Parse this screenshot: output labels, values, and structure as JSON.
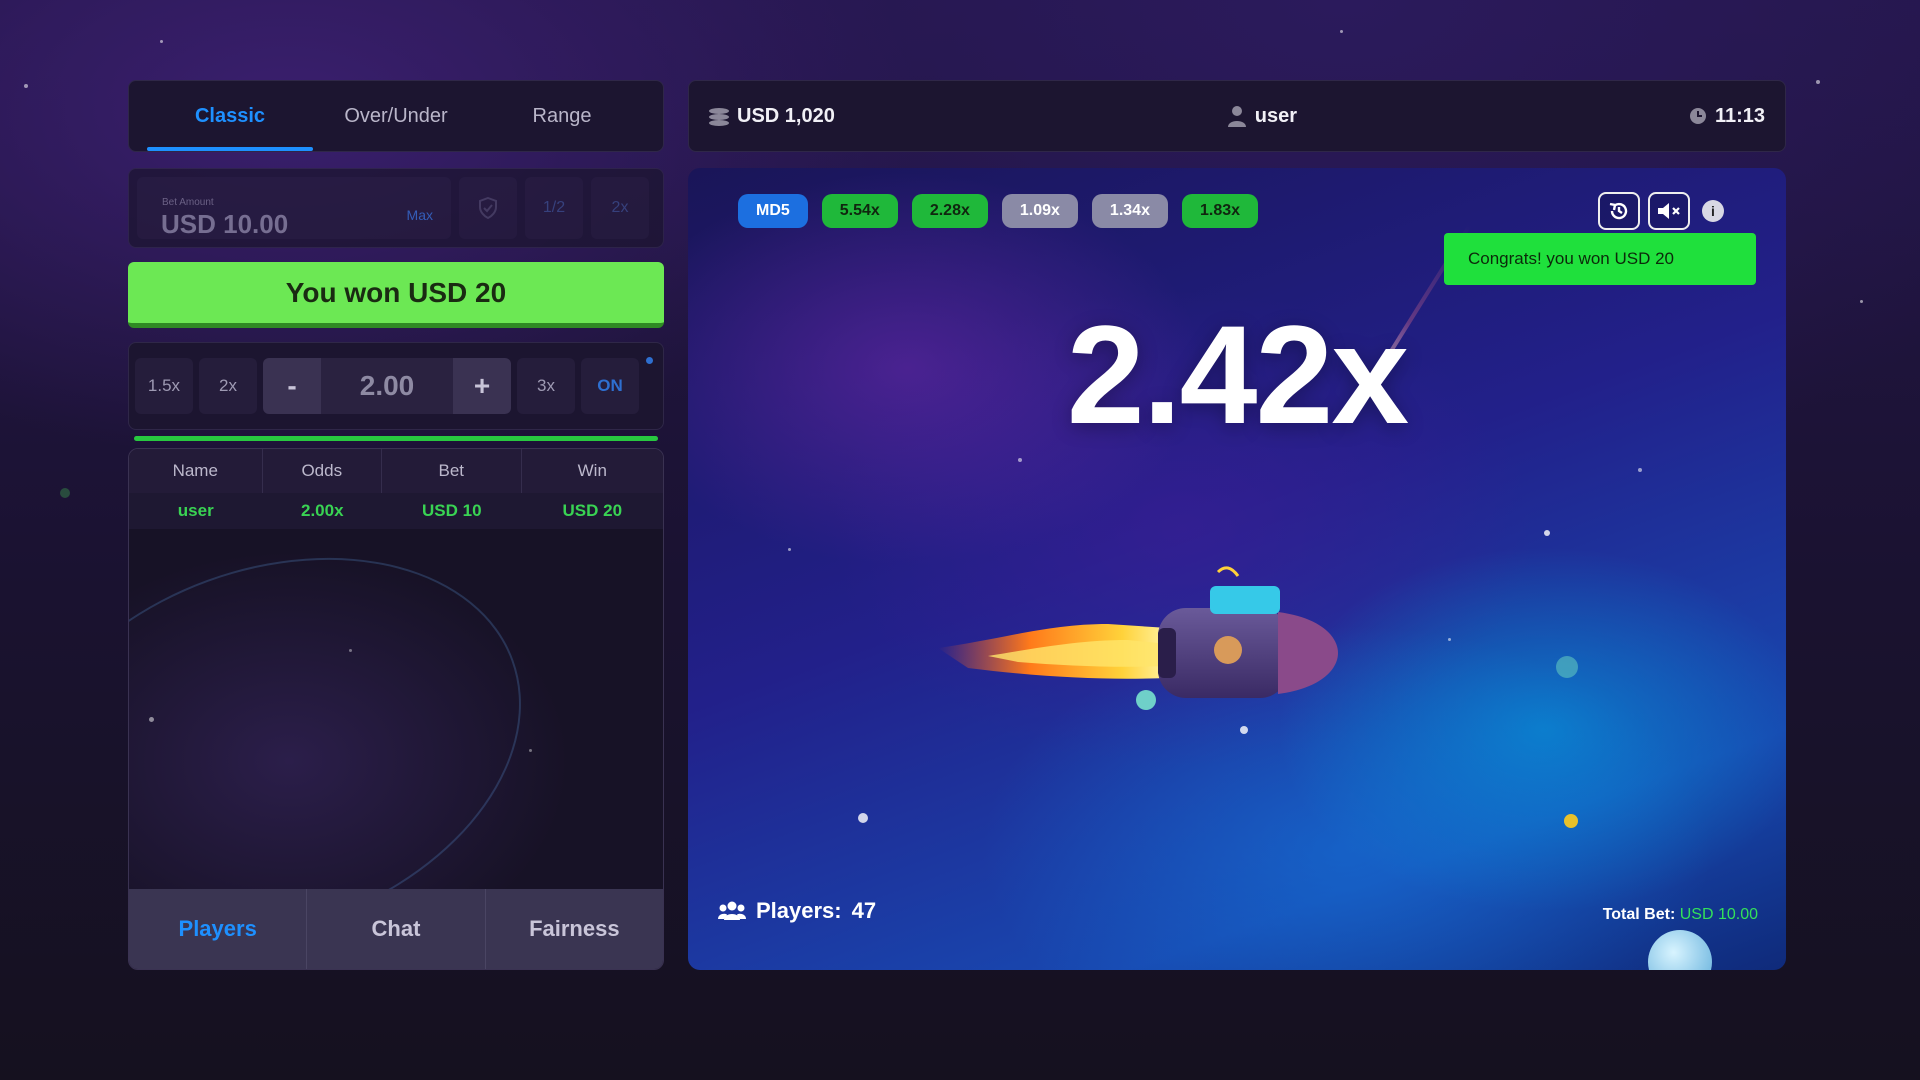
{
  "mode_tabs": [
    "Classic",
    "Over/Under",
    "Range"
  ],
  "bet": {
    "label": "Bet Amount",
    "value": "USD 10.00",
    "max_label": "Max",
    "half_label": "1/2",
    "double_label": "2x"
  },
  "won_button": "You won USD 20",
  "multiplier_controls": {
    "preset_1": "1.5x",
    "preset_2": "2x",
    "minus": "-",
    "value": "2.00",
    "plus": "+",
    "preset_3": "3x",
    "auto": "ON",
    "progress": 1.0
  },
  "table": {
    "headers": [
      "Name",
      "Odds",
      "Bet",
      "Win"
    ],
    "rows": [
      [
        "user",
        "2.00x",
        "USD 10",
        "USD 20"
      ]
    ]
  },
  "bottom_tabs": [
    "Players",
    "Chat",
    "Fairness"
  ],
  "topbar": {
    "balance": "USD 1,020",
    "username": "user",
    "time": "11:13"
  },
  "history_chips": [
    {
      "label": "MD5",
      "style": "blue"
    },
    {
      "label": "5.54x",
      "style": "green"
    },
    {
      "label": "2.28x",
      "style": "green"
    },
    {
      "label": "1.09x",
      "style": "gray"
    },
    {
      "label": "1.34x",
      "style": "gray"
    },
    {
      "label": "1.83x",
      "style": "green"
    }
  ],
  "toast": "Congrats! you won USD 20",
  "current_multiplier": "2.42x",
  "players": {
    "label": "Players:",
    "count": "47"
  },
  "total_bet": {
    "label": "Total Bet:",
    "value": "USD 10.00"
  },
  "icons": [
    "history-icon",
    "mute-icon",
    "info-icon"
  ],
  "colors": {
    "accent": "#1e90ff",
    "win_green": "#6ce854",
    "chip_green": "#1fb83a"
  }
}
